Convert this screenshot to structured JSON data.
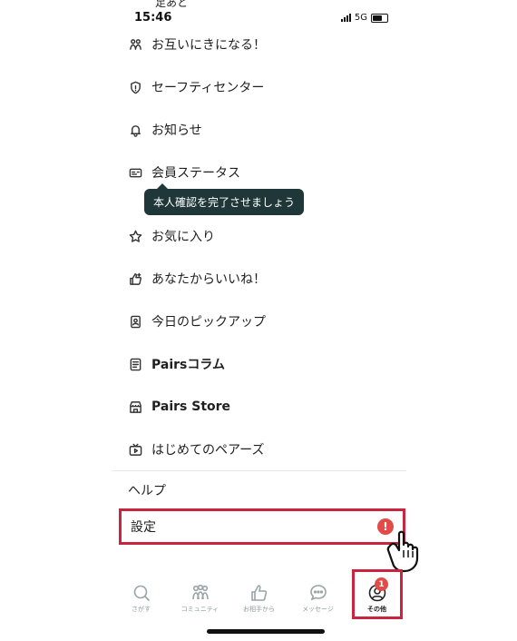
{
  "status_bar": {
    "top_text": "足あと",
    "time": "15:46",
    "network": "5G"
  },
  "menu": [
    {
      "label": "お互いにきになる！",
      "icon": "mutual-icon"
    },
    {
      "label": "セーフティセンター",
      "icon": "shield-icon"
    },
    {
      "label": "お知らせ",
      "icon": "bell-icon"
    },
    {
      "label": "会員ステータス",
      "icon": "member-card-icon"
    },
    {
      "label": "お気に入り",
      "icon": "star-icon"
    },
    {
      "label": "あなたからいいね！",
      "icon": "thumbs-up-icon"
    },
    {
      "label": "今日のピックアップ",
      "icon": "pickup-icon"
    },
    {
      "label": "Pairsコラム",
      "icon": "column-icon"
    },
    {
      "label": "Pairs Store",
      "icon": "store-icon"
    },
    {
      "label": "はじめてのペアーズ",
      "icon": "tv-icon"
    }
  ],
  "tooltip": "本人確認を完了させましょう",
  "help_label": "ヘルプ",
  "settings": {
    "label": "設定",
    "alert": "!"
  },
  "tabbar": [
    {
      "label": "さがす",
      "icon": "search-icon"
    },
    {
      "label": "コミュニティ",
      "icon": "community-icon"
    },
    {
      "label": "お相手から",
      "icon": "thumbs-up-icon"
    },
    {
      "label": "メッセージ",
      "icon": "message-icon"
    },
    {
      "label": "その他",
      "icon": "profile-icon",
      "badge": "1"
    }
  ],
  "colors": {
    "highlight": "#c9253f",
    "alert": "#e34b48",
    "tooltip_bg": "#20373a"
  }
}
